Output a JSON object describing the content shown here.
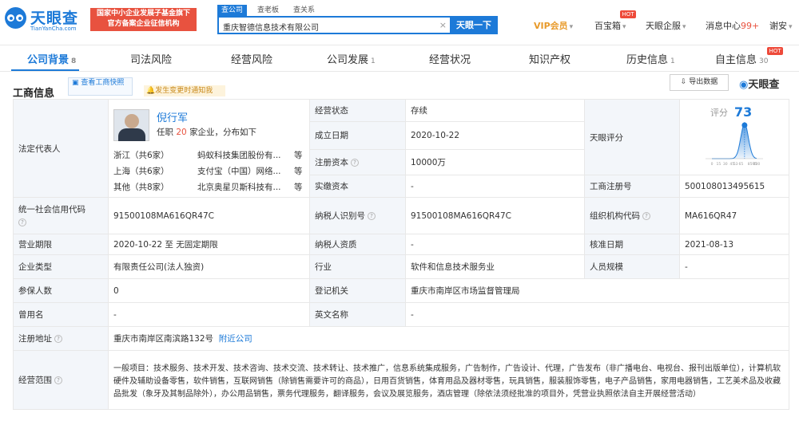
{
  "header": {
    "logo_text": "天眼查",
    "logo_sub": "TianYanCha.com",
    "badge_line1": "国家中小企业发展子基金旗下",
    "badge_line2": "官方备案企业征信机构",
    "search_tabs": [
      "查公司",
      "查老板",
      "查关系"
    ],
    "search_value": "重庆智德信息技术有限公司",
    "search_button": "天眼一下",
    "vip": "VIP会员",
    "baibaoxiang": "百宝箱",
    "qiban": "天眼企服",
    "messages": "消息中心",
    "messages_count": "99+",
    "user": "谢安",
    "hot": "HOT"
  },
  "tabs": [
    {
      "label": "公司背景",
      "count": "8"
    },
    {
      "label": "司法风险",
      "count": ""
    },
    {
      "label": "经营风险",
      "count": ""
    },
    {
      "label": "公司发展",
      "count": "1"
    },
    {
      "label": "经营状况",
      "count": ""
    },
    {
      "label": "知识产权",
      "count": ""
    },
    {
      "label": "历史信息",
      "count": "1"
    },
    {
      "label": "自主信息",
      "count": "30"
    }
  ],
  "section": {
    "title": "工商信息",
    "quick_view": "查看工商快照",
    "notify": "发生变更时通知我",
    "export": "导出数据",
    "brand": "天眼查"
  },
  "legal_rep": {
    "label": "法定代表人",
    "name": "倪行军",
    "tenure_prefix": "任职",
    "tenure_count": "20",
    "tenure_suffix": "家企业，分布如下",
    "regions": [
      {
        "region": "浙江（共6家）",
        "company": "蚂蚁科技集团股份有...",
        "more": "等"
      },
      {
        "region": "上海（共6家）",
        "company": "支付宝（中国）网络...",
        "more": "等"
      },
      {
        "region": "其他（共8家）",
        "company": "北京奥星贝斯科技有...",
        "more": "等"
      }
    ]
  },
  "fields": {
    "status_label": "经营状态",
    "status": "存续",
    "est_label": "成立日期",
    "est": "2020-10-22",
    "capital_label": "注册资本",
    "capital": "10000万",
    "paid_label": "实缴资本",
    "paid": "-",
    "score_label": "天眼评分",
    "score_text": "评分",
    "score": "73",
    "regno_label": "工商注册号",
    "regno": "500108013495615",
    "credit_label": "统一社会信用代码",
    "credit": "91500108MA616QR47C",
    "taxid_label": "纳税人识别号",
    "taxid": "91500108MA616QR47C",
    "orgcode_label": "组织机构代码",
    "orgcode": "MA616QR47",
    "term_label": "营业期限",
    "term": "2020-10-22 至 无固定期限",
    "taxqual_label": "纳税人资质",
    "taxqual": "-",
    "approve_label": "核准日期",
    "approve": "2021-08-13",
    "type_label": "企业类型",
    "type": "有限责任公司(法人独资)",
    "industry_label": "行业",
    "industry": "软件和信息技术服务业",
    "staff_label": "人员规模",
    "staff": "-",
    "insured_label": "参保人数",
    "insured": "0",
    "authority_label": "登记机关",
    "authority": "重庆市南岸区市场监督管理局",
    "former_label": "曾用名",
    "former": "-",
    "english_label": "英文名称",
    "english": "-",
    "address_label": "注册地址",
    "address": "重庆市南岸区南滨路132号",
    "nearby": "附近公司",
    "scope_label": "经营范围",
    "scope": "一般项目：技术服务、技术开发、技术咨询、技术交流、技术转让、技术推广，信息系统集成服务，广告制作，广告设计、代理，广告发布（非广播电台、电视台、报刊出版单位），计算机软硬件及辅助设备零售，软件销售，互联网销售（除销售需要许可的商品），日用百货销售，体育用品及器材零售，玩具销售，服装服饰零售，电子产品销售，家用电器销售，工艺美术品及收藏品批发（象牙及其制品除外），办公用品销售，票务代理服务，翻译服务，会议及展览服务，酒店管理（除依法须经批准的项目外，凭营业执照依法自主开展经营活动）"
  },
  "chart_data": {
    "type": "area",
    "x_ticks": [
      "0",
      "15",
      "30",
      "45",
      "53",
      "65",
      "85",
      "95",
      "100"
    ],
    "marker": 73,
    "color": "#1d7ad8"
  }
}
